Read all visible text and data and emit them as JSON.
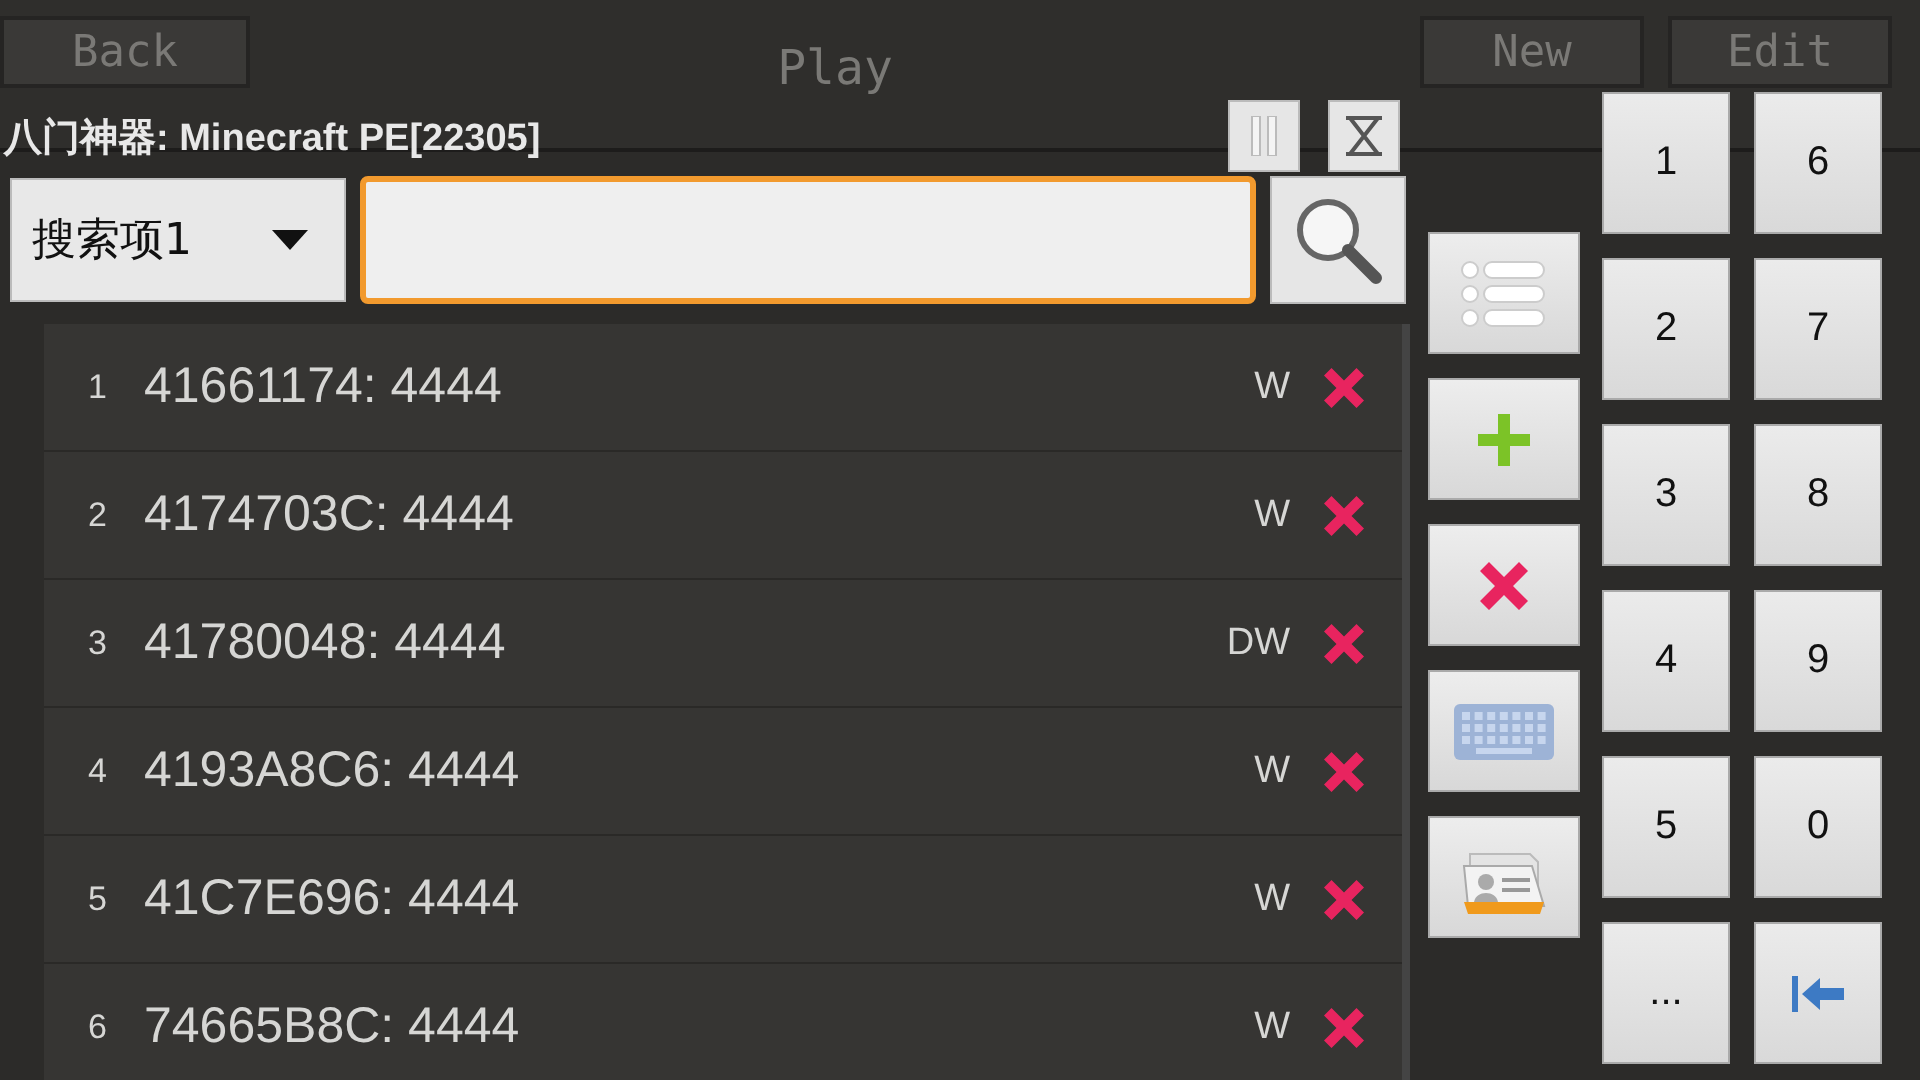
{
  "background_menu": {
    "title": "Play",
    "buttons": [
      {
        "kind": "left",
        "label": "Back"
      },
      {
        "kind": "right",
        "label": "New"
      },
      {
        "kind": "right",
        "label": "Edit"
      }
    ]
  },
  "title": "八门神器: Minecraft PE[22305]",
  "top_buttons": [
    {
      "kind": "pause"
    },
    {
      "kind": "hourglass"
    }
  ],
  "search": {
    "dropdown": "搜索项1"
  },
  "results": [
    {
      "index": "1",
      "entry": "41661174: 4444",
      "type": "W"
    },
    {
      "index": "2",
      "entry": "4174703C: 4444",
      "type": "W"
    },
    {
      "index": "3",
      "entry": "41780048: 4444",
      "type": "DW"
    },
    {
      "index": "4",
      "entry": "4193A8C6: 4444",
      "type": "W"
    },
    {
      "index": "5",
      "entry": "41C7E696: 4444",
      "type": "W"
    },
    {
      "index": "6",
      "entry": "74665B8C: 4444",
      "type": "W"
    }
  ],
  "tools": [
    {
      "kind": "list"
    },
    {
      "kind": "add"
    },
    {
      "kind": "delete"
    },
    {
      "kind": "keyboard"
    },
    {
      "kind": "contacts"
    }
  ],
  "keypad": [
    {
      "kind": "digit",
      "label": "1"
    },
    {
      "kind": "digit",
      "label": "6"
    },
    {
      "kind": "digit",
      "label": "2"
    },
    {
      "kind": "digit",
      "label": "7"
    },
    {
      "kind": "digit",
      "label": "3"
    },
    {
      "kind": "digit",
      "label": "8"
    },
    {
      "kind": "digit",
      "label": "4"
    },
    {
      "kind": "digit",
      "label": "9"
    },
    {
      "kind": "digit",
      "label": "5"
    },
    {
      "kind": "digit",
      "label": "0"
    },
    {
      "kind": "digit",
      "label": "..."
    },
    {
      "kind": "backspace"
    }
  ]
}
